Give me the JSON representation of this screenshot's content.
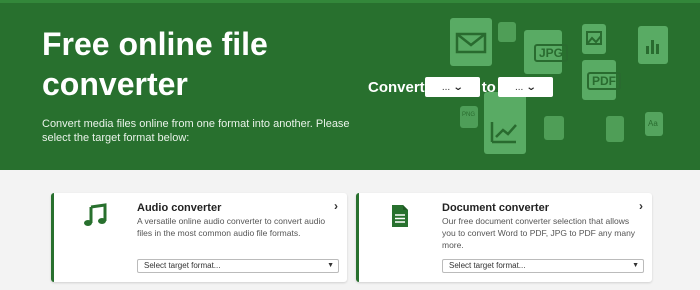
{
  "hero": {
    "title": "Free online file converter",
    "subtitle": "Convert media files online from one format into another. Please select the target format below:",
    "convert_label": "Convert",
    "to_label": "to",
    "from_select": "...",
    "to_select": "...",
    "background_color": "#28702e",
    "icon_labels": {
      "jpg": "JPG",
      "pdf": "PDF",
      "png": "PNG",
      "aa": "Aa"
    }
  },
  "cards": [
    {
      "title": "Audio converter",
      "description": "A versatile online audio converter to convert audio files in the most common audio file formats.",
      "select_placeholder": "Select target format...",
      "icon": "music-note-icon"
    },
    {
      "title": "Document converter",
      "description": "Our free document converter selection that allows you to convert Word to PDF, JPG to PDF any many more.",
      "select_placeholder": "Select target format...",
      "icon": "document-icon"
    }
  ],
  "colors": {
    "accent": "#28702e",
    "icon_green": "#5fb26a"
  }
}
